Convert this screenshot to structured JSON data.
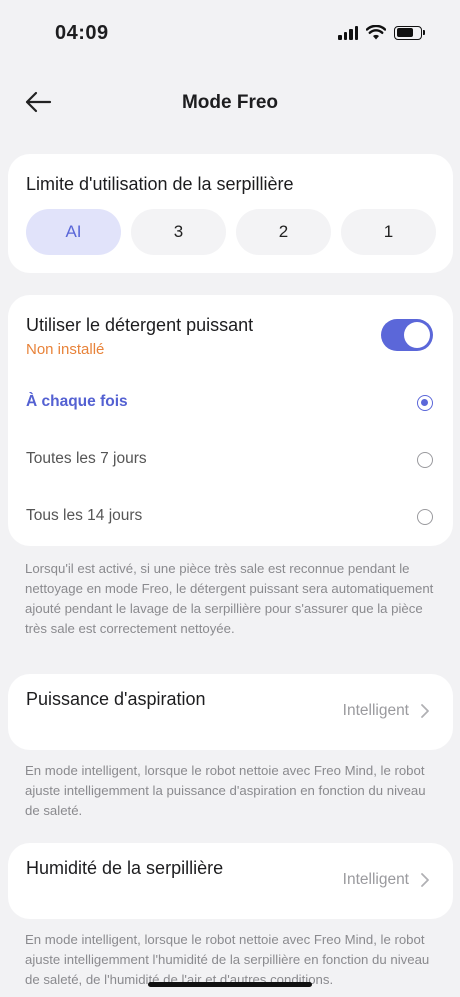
{
  "status_bar": {
    "time": "04:09"
  },
  "nav": {
    "title": "Mode Freo",
    "back_icon": "arrow-left-icon"
  },
  "mop_limit": {
    "title": "Limite d'utilisation de la serpillière",
    "options": [
      "AI",
      "3",
      "2",
      "1"
    ],
    "selected": "AI"
  },
  "detergent": {
    "title": "Utiliser le détergent puissant",
    "status": "Non installé",
    "toggle_on": true,
    "frequency_options": [
      "À chaque fois",
      "Toutes les 7 jours",
      "Tous les 14 jours"
    ],
    "selected": "À chaque fois",
    "description": "Lorsqu'il est activé, si une pièce très sale est reconnue pendant le nettoyage en mode Freo, le détergent puissant sera automatiquement ajouté pendant le lavage de la serpillière pour s'assurer que la pièce très sale est correctement nettoyée."
  },
  "suction": {
    "label": "Puissance d'aspiration",
    "value": "Intelligent",
    "description": "En mode intelligent, lorsque le robot nettoie avec Freo Mind, le robot ajuste intelligemment la puissance d'aspiration en fonction du niveau de saleté."
  },
  "humidity": {
    "label": "Humidité de la serpillière",
    "value": "Intelligent",
    "description": "En mode intelligent, lorsque le robot nettoie avec Freo Mind, le robot ajuste intelligemment l'humidité de la serpillière en fonction du niveau de saleté, de l'humidité de l'air et d'autres conditions."
  },
  "colors": {
    "accent": "#5b67d9",
    "warning": "#e8833a",
    "background": "#f2f2f4"
  }
}
